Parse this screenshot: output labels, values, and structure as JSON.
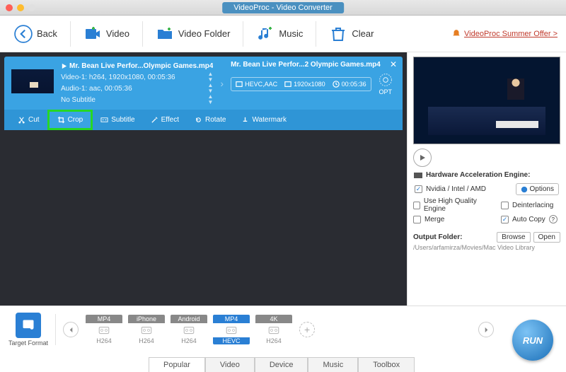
{
  "window": {
    "title": "VideoProc - Video Converter"
  },
  "toolbar": {
    "back": "Back",
    "video": "Video",
    "video_folder": "Video Folder",
    "music": "Music",
    "clear": "Clear",
    "summer_offer": "VideoProc Summer Offer >"
  },
  "source": {
    "filename": "Mr. Bean Live Perfor...Olympic Games.mp4",
    "video_line": "Video-1: h264, 1920x1080, 00:05:36",
    "audio_line": "Audio-1: aac, 00:05:36",
    "subtitle_line": "No Subtitle"
  },
  "dest": {
    "filename": "Mr. Bean Live Perfor...2 Olympic Games.mp4",
    "codec": "HEVC,AAC",
    "resolution": "1920x1080",
    "duration": "00:05:36",
    "opt_label": "OPT"
  },
  "edit": {
    "cut": "Cut",
    "crop": "Crop",
    "subtitle": "Subtitle",
    "effect": "Effect",
    "rotate": "Rotate",
    "watermark": "Watermark"
  },
  "hw": {
    "header": "Hardware Acceleration Engine:",
    "nvidia": "Nvidia / Intel / AMD",
    "options": "Options",
    "hq": "Use High Quality Engine",
    "deint": "Deinterlacing",
    "merge": "Merge",
    "autocopy": "Auto Copy"
  },
  "output": {
    "label": "Output Folder:",
    "browse": "Browse",
    "open": "Open",
    "path": "/Users/arfamirza/Movies/Mac Video Library"
  },
  "target_format_label": "Target Format",
  "presets": [
    {
      "top": "MP4",
      "bot": "H264",
      "selected": false
    },
    {
      "top": "iPhone",
      "bot": "H264",
      "selected": false
    },
    {
      "top": "Android",
      "bot": "H264",
      "selected": false
    },
    {
      "top": "MP4",
      "bot": "HEVC",
      "selected": true
    },
    {
      "top": "4K",
      "bot": "H264",
      "selected": false
    }
  ],
  "tabs": [
    "Popular",
    "Video",
    "Device",
    "Music",
    "Toolbox"
  ],
  "active_tab": "Popular",
  "run_label": "RUN"
}
